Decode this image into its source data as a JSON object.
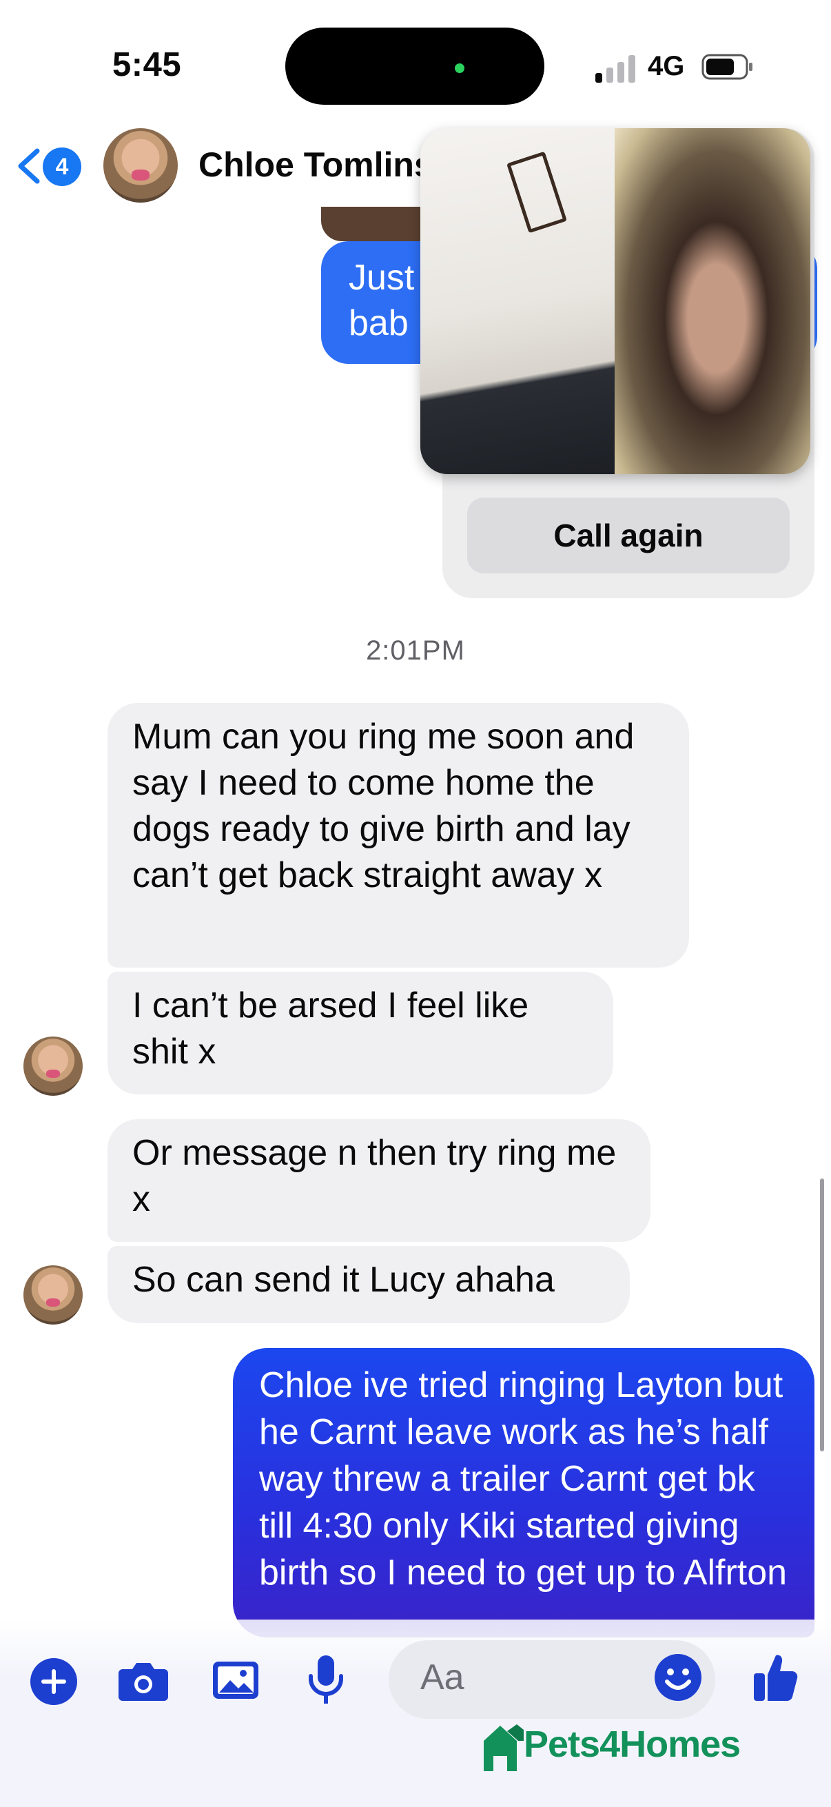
{
  "status_bar": {
    "time": "5:45",
    "network": "4G"
  },
  "header": {
    "back_count": "4",
    "contact_name": "Chloe Tomlinson"
  },
  "conversation": {
    "old_sent_partial": [
      "Just",
      "bab"
    ],
    "call_card": {
      "call_again_label": "Call again"
    },
    "timestamp": "2:01PM",
    "received": [
      {
        "text": "Mum can you ring me soon and say I need to come home the dogs ready to give birth and lay can’t get back straight away x"
      },
      {
        "text": "I can’t be arsed I feel like shit x"
      },
      {
        "text": "Or message n then try ring me x"
      },
      {
        "text": "So can send it Lucy ahaha"
      }
    ],
    "sent": {
      "text": "Chloe ive tried ringing Layton but he Carnt leave work as he’s half way threw a trailer Carnt get bk till 4:30 only Kiki started giving birth so I need to get up to Alfrton"
    }
  },
  "composer": {
    "placeholder": "Aa"
  },
  "watermark": {
    "text": "Pets4Homes"
  },
  "colors": {
    "accent": "#1877f2",
    "sent_bubble": "#1c47ef",
    "received_bubble": "#f0f0f2",
    "composer_icon": "#1d3fd0",
    "watermark": "#12915a"
  }
}
